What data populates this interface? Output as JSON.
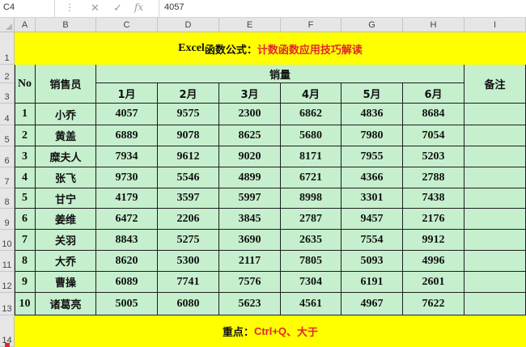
{
  "formula_bar": {
    "cell_ref": "C4",
    "dots": "⋮",
    "cancel_icon": "✕",
    "enter_icon": "✓",
    "fx_icon": "fx",
    "value": "4057"
  },
  "columns": [
    "A",
    "B",
    "C",
    "D",
    "E",
    "F",
    "G",
    "H",
    "I"
  ],
  "rows": [
    "1",
    "2",
    "3",
    "4",
    "5",
    "6",
    "7",
    "8",
    "9",
    "10",
    "11",
    "12",
    "13",
    "14"
  ],
  "title": {
    "part1": "Excel",
    "part2": "函数公式：",
    "part3": "计数函数应用技巧解读"
  },
  "table": {
    "header_no": "No",
    "header_name": "销售员",
    "header_sales": "销量",
    "header_remark": "备注",
    "months": [
      "1月",
      "2月",
      "3月",
      "4月",
      "5月",
      "6月"
    ],
    "records": [
      {
        "no": "1",
        "name": "小乔",
        "values": [
          "4057",
          "9575",
          "2300",
          "6862",
          "4836",
          "8684"
        ]
      },
      {
        "no": "2",
        "name": "黄盖",
        "values": [
          "6889",
          "9078",
          "8625",
          "5680",
          "7980",
          "7054"
        ]
      },
      {
        "no": "3",
        "name": "糜夫人",
        "values": [
          "7934",
          "9612",
          "9020",
          "8171",
          "7955",
          "5203"
        ]
      },
      {
        "no": "4",
        "name": "张飞",
        "values": [
          "9730",
          "5546",
          "4899",
          "6721",
          "4366",
          "2788"
        ]
      },
      {
        "no": "5",
        "name": "甘宁",
        "values": [
          "4179",
          "3597",
          "5997",
          "8998",
          "3301",
          "7438"
        ]
      },
      {
        "no": "6",
        "name": "姜维",
        "values": [
          "6472",
          "2206",
          "3845",
          "2787",
          "9457",
          "2176"
        ]
      },
      {
        "no": "7",
        "name": "关羽",
        "values": [
          "8843",
          "5275",
          "3690",
          "2635",
          "7554",
          "9912"
        ]
      },
      {
        "no": "8",
        "name": "大乔",
        "values": [
          "8620",
          "5300",
          "2117",
          "7805",
          "5093",
          "4996"
        ]
      },
      {
        "no": "9",
        "name": "曹操",
        "values": [
          "6089",
          "7741",
          "7576",
          "7304",
          "6191",
          "2601"
        ]
      },
      {
        "no": "10",
        "name": "诸葛亮",
        "values": [
          "5005",
          "6080",
          "5623",
          "4561",
          "4967",
          "7622"
        ]
      }
    ]
  },
  "note": {
    "label": "重点：",
    "keys": "Ctrl+Q",
    "sep": "、",
    "tip": "大于"
  },
  "colors": {
    "band_yellow": "#ffff00",
    "table_green": "#c6efce",
    "accent_red": "#e3262c",
    "month_blue": "#1f3a93"
  }
}
